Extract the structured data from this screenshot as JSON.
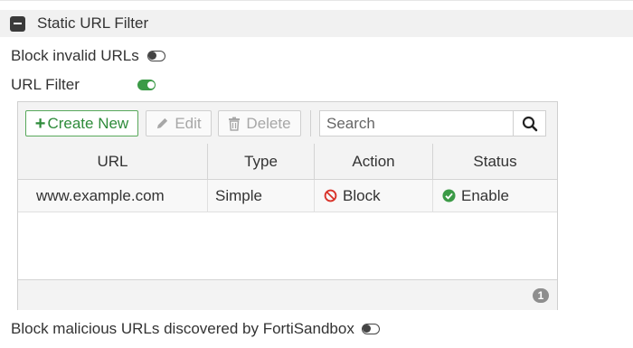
{
  "section": {
    "title": "Static URL Filter"
  },
  "block_invalid_urls": {
    "label": "Block invalid URLs",
    "enabled": false
  },
  "url_filter": {
    "label": "URL Filter",
    "enabled": true
  },
  "toolbar": {
    "create_label": "Create New",
    "edit_label": "Edit",
    "delete_label": "Delete",
    "search_placeholder": "Search"
  },
  "table": {
    "columns": [
      "URL",
      "Type",
      "Action",
      "Status"
    ],
    "rows": [
      {
        "url": "www.example.com",
        "type": "Simple",
        "action": "Block",
        "status": "Enable"
      }
    ],
    "count": "1"
  },
  "block_malicious": {
    "label": "Block malicious URLs discovered by FortiSandbox",
    "enabled": false
  },
  "colors": {
    "accent_green": "#3b9a46",
    "block_red": "#d9342b",
    "badge_gray": "#8e8e8e"
  }
}
